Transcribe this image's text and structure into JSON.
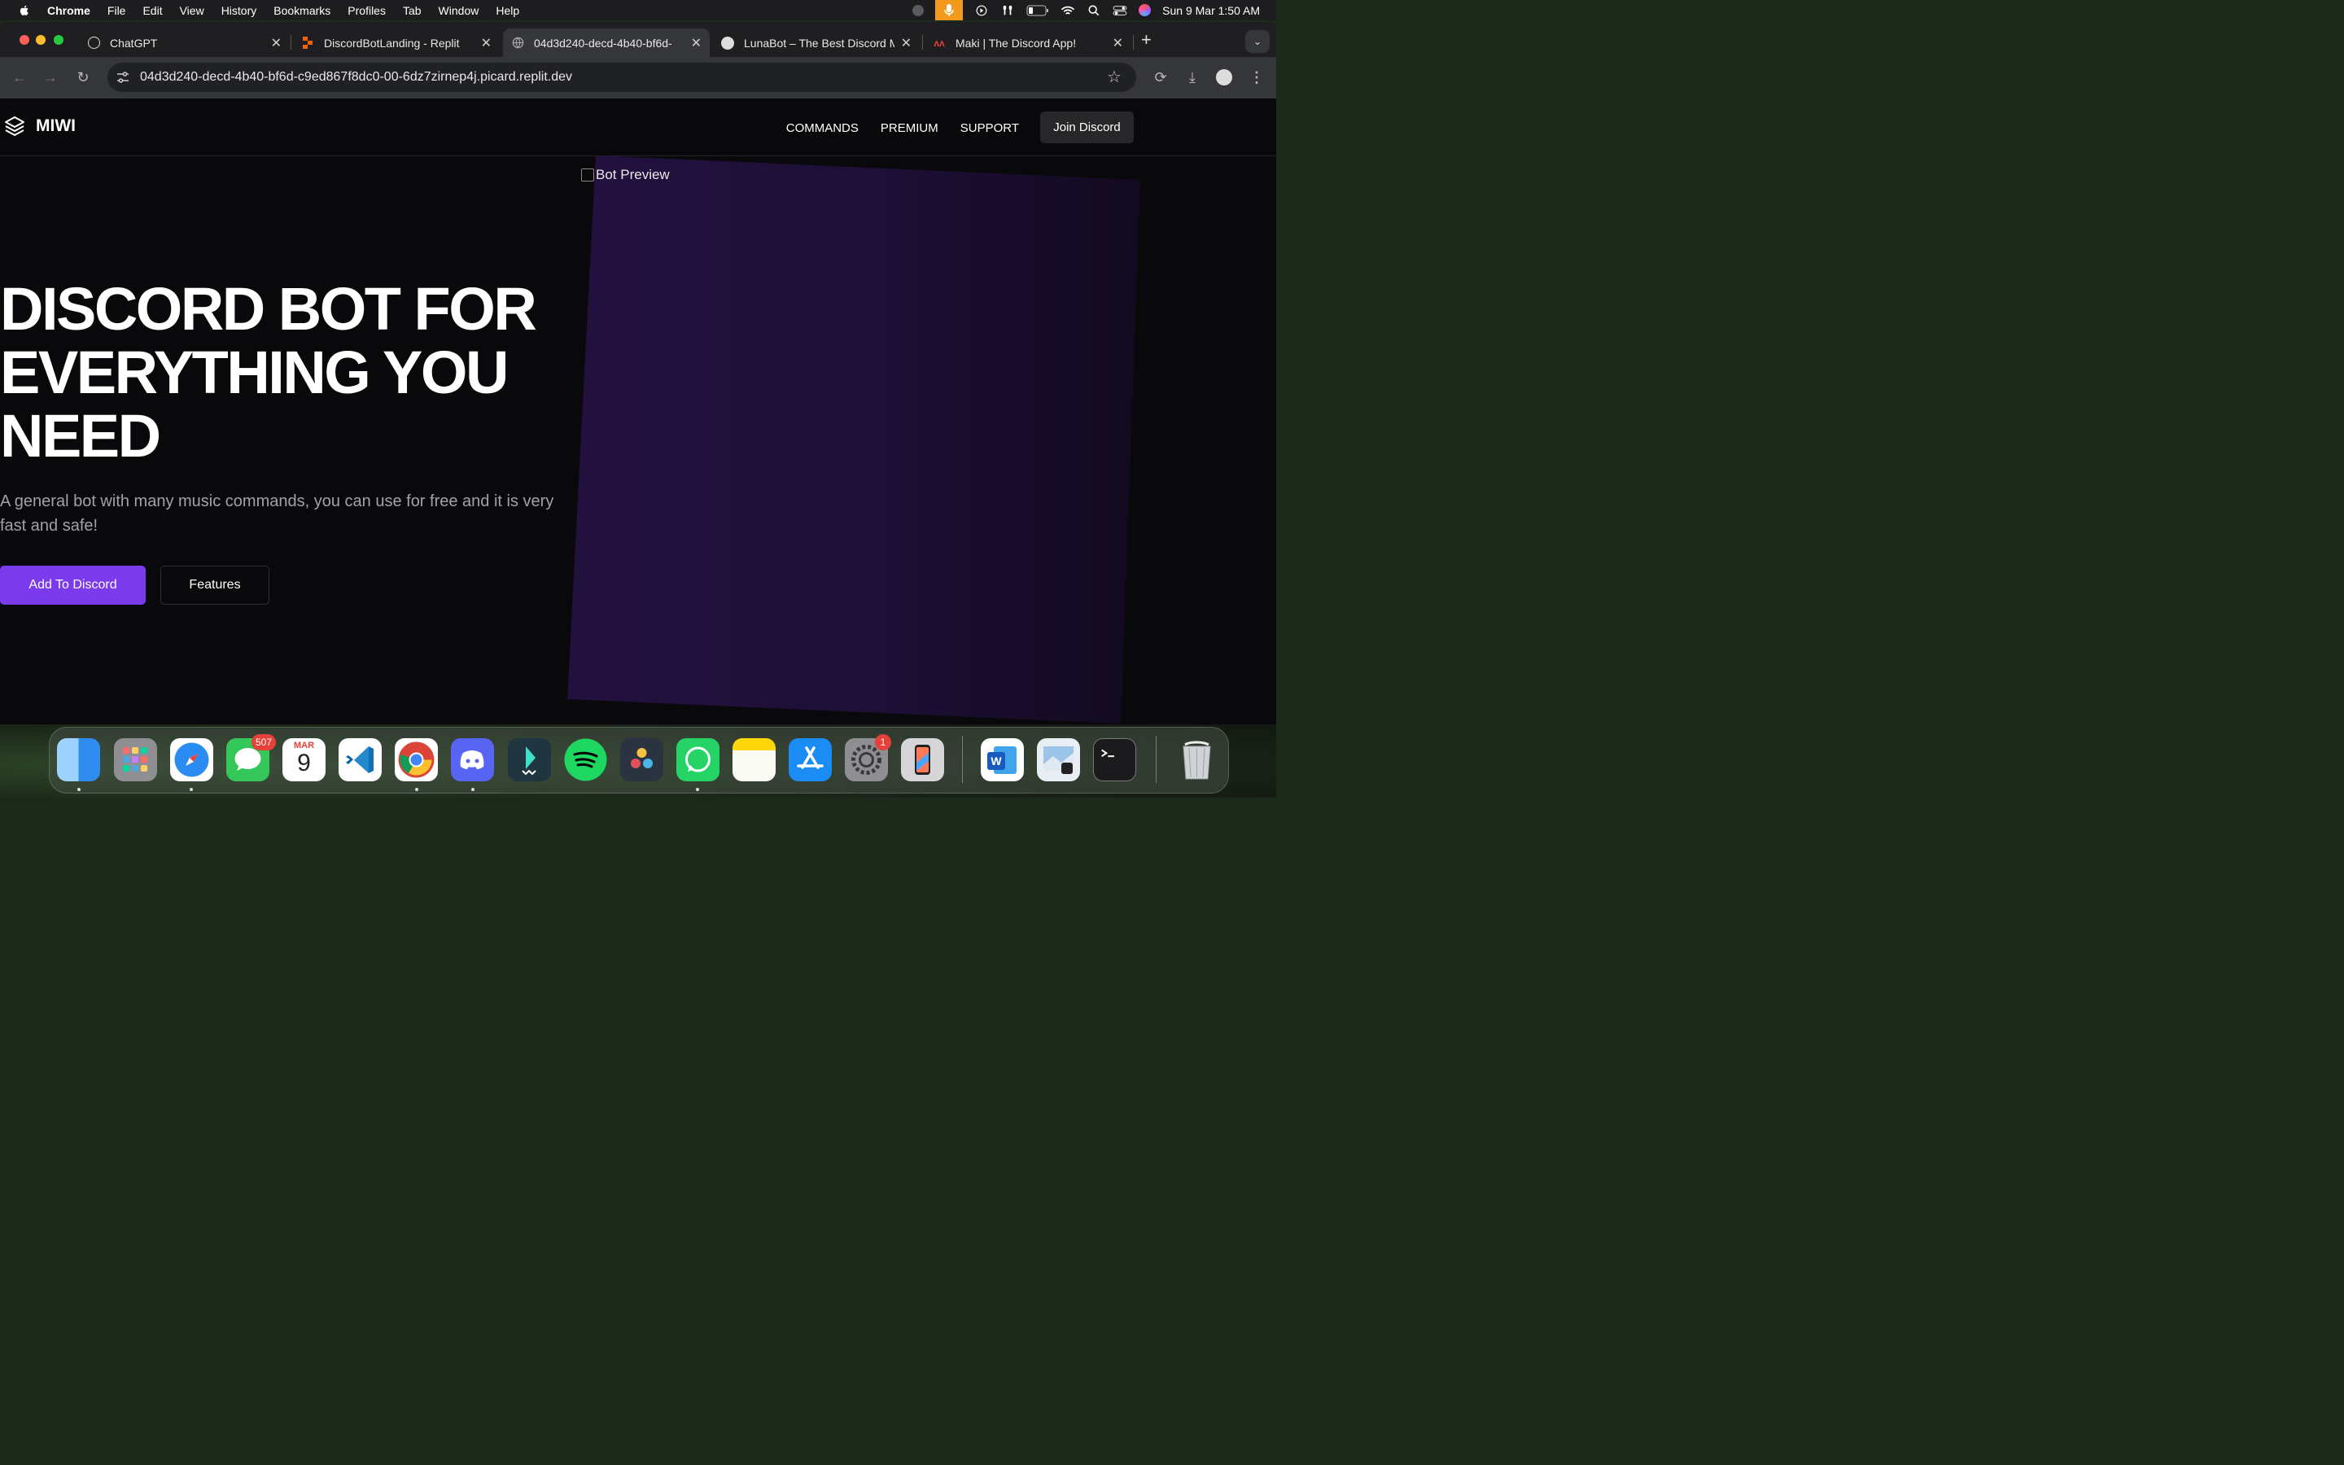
{
  "menubar": {
    "app_name": "Chrome",
    "menus": [
      "File",
      "Edit",
      "View",
      "History",
      "Bookmarks",
      "Profiles",
      "Tab",
      "Window",
      "Help"
    ],
    "clock": "Sun 9 Mar  1:50 AM"
  },
  "tabs": [
    {
      "title": "ChatGPT",
      "icon": "chatgpt-icon",
      "active": false
    },
    {
      "title": "DiscordBotLanding - Replit",
      "icon": "replit-icon",
      "active": false
    },
    {
      "title": "04d3d240-decd-4b40-bf6d-",
      "icon": "globe-icon",
      "active": true
    },
    {
      "title": "LunaBot – The Best Discord M",
      "icon": "lunabot-icon",
      "active": false
    },
    {
      "title": "Maki | The Discord App!",
      "icon": "maki-icon",
      "active": false
    }
  ],
  "address_bar": {
    "url": "04d3d240-decd-4b40-bf6d-c9ed867f8dc0-00-6dz7zirnep4j.picard.replit.dev"
  },
  "site": {
    "brand": "MIWI",
    "nav_links": [
      "COMMANDS",
      "PREMIUM",
      "SUPPORT"
    ],
    "join_label": "Join Discord",
    "preview_alt": "Bot Preview",
    "hero_title": "DISCORD BOT FOR EVERYTHING YOU NEED",
    "hero_subtitle": "A general bot with many music commands, you can use for free and it is very fast and safe!",
    "primary_cta": "Add To Discord",
    "secondary_cta": "Features",
    "accent_color": "#7c3aed"
  },
  "dock": {
    "messages_badge": "507",
    "calendar_month": "MAR",
    "calendar_day": "9",
    "settings_badge": "1",
    "apps": [
      "finder-icon",
      "launchpad-icon",
      "safari-icon",
      "messages-icon",
      "calendar-icon",
      "vscode-icon",
      "chrome-icon",
      "discord-icon",
      "filmora-icon",
      "spotify-icon",
      "davinci-resolve-icon",
      "whatsapp-icon",
      "notes-icon",
      "app-store-icon",
      "system-settings-icon",
      "iphone-mirroring-icon",
      "word-icon",
      "preview-icon",
      "terminal-icon",
      "trash-icon"
    ]
  }
}
